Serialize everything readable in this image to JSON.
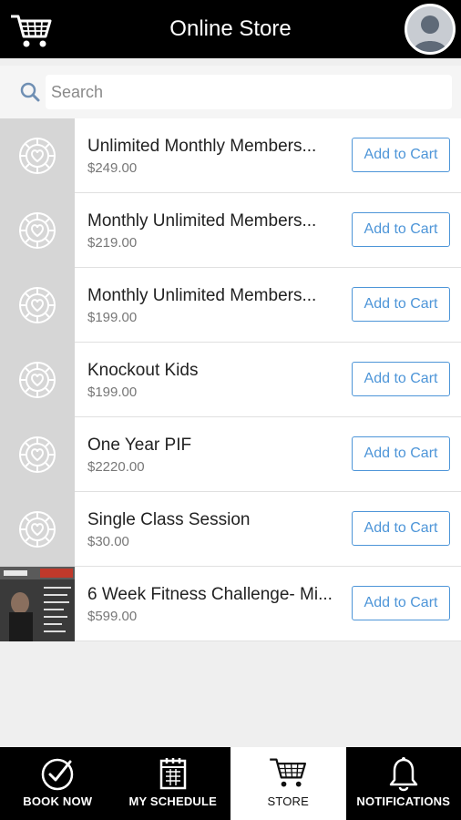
{
  "header": {
    "title": "Online Store",
    "icons": {
      "left": "shopping-cart-icon",
      "right": "user-avatar"
    }
  },
  "search": {
    "placeholder": "Search",
    "icon": "search-icon"
  },
  "items": [
    {
      "name": "Unlimited Monthly Members...",
      "price": "$249.00",
      "button": "Add to Cart",
      "thumbnail": "placeholder"
    },
    {
      "name": "Monthly Unlimited Members...",
      "price": "$219.00",
      "button": "Add to Cart",
      "thumbnail": "placeholder"
    },
    {
      "name": "Monthly Unlimited Members...",
      "price": "$199.00",
      "button": "Add to Cart",
      "thumbnail": "placeholder"
    },
    {
      "name": "Knockout Kids",
      "price": "$199.00",
      "button": "Add to Cart",
      "thumbnail": "placeholder"
    },
    {
      "name": "One Year PIF",
      "price": "$2220.00",
      "button": "Add to Cart",
      "thumbnail": "placeholder"
    },
    {
      "name": "Single Class Session",
      "price": "$30.00",
      "button": "Add to Cart",
      "thumbnail": "placeholder"
    },
    {
      "name": "6 Week Fitness Challenge- Mi...",
      "price": "$599.00",
      "button": "Add to Cart",
      "thumbnail": "photo"
    }
  ],
  "tabs": [
    {
      "label": "BOOK NOW",
      "icon": "check-circle-icon",
      "active": false
    },
    {
      "label": "MY SCHEDULE",
      "icon": "calendar-icon",
      "active": false
    },
    {
      "label": "STORE",
      "icon": "shopping-cart-icon",
      "active": true
    },
    {
      "label": "NOTIFICATIONS",
      "icon": "bell-icon",
      "active": false
    }
  ],
  "colors": {
    "header_bg": "#000000",
    "accent": "#4d95d8",
    "thumb_bg": "#d6d6d6"
  }
}
